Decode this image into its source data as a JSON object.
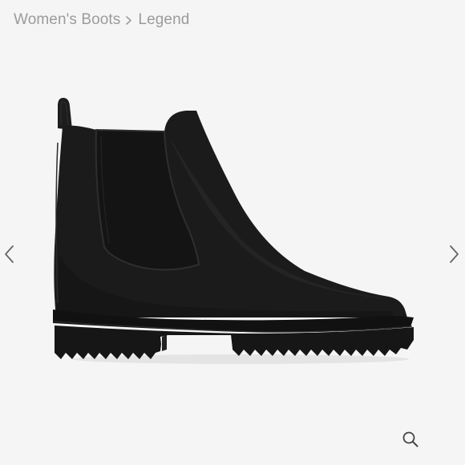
{
  "breadcrumb": {
    "items": [
      {
        "label": "Women's Boots"
      },
      {
        "label": "Legend"
      }
    ]
  },
  "gallery": {
    "prev_icon": "chevron-left-icon",
    "next_icon": "chevron-right-icon",
    "zoom_icon": "magnifier-icon"
  },
  "colors": {
    "background": "#f5f5f5",
    "breadcrumb_text": "#9b9b9b",
    "boot": "#1b1b1b",
    "icon": "#555555"
  }
}
